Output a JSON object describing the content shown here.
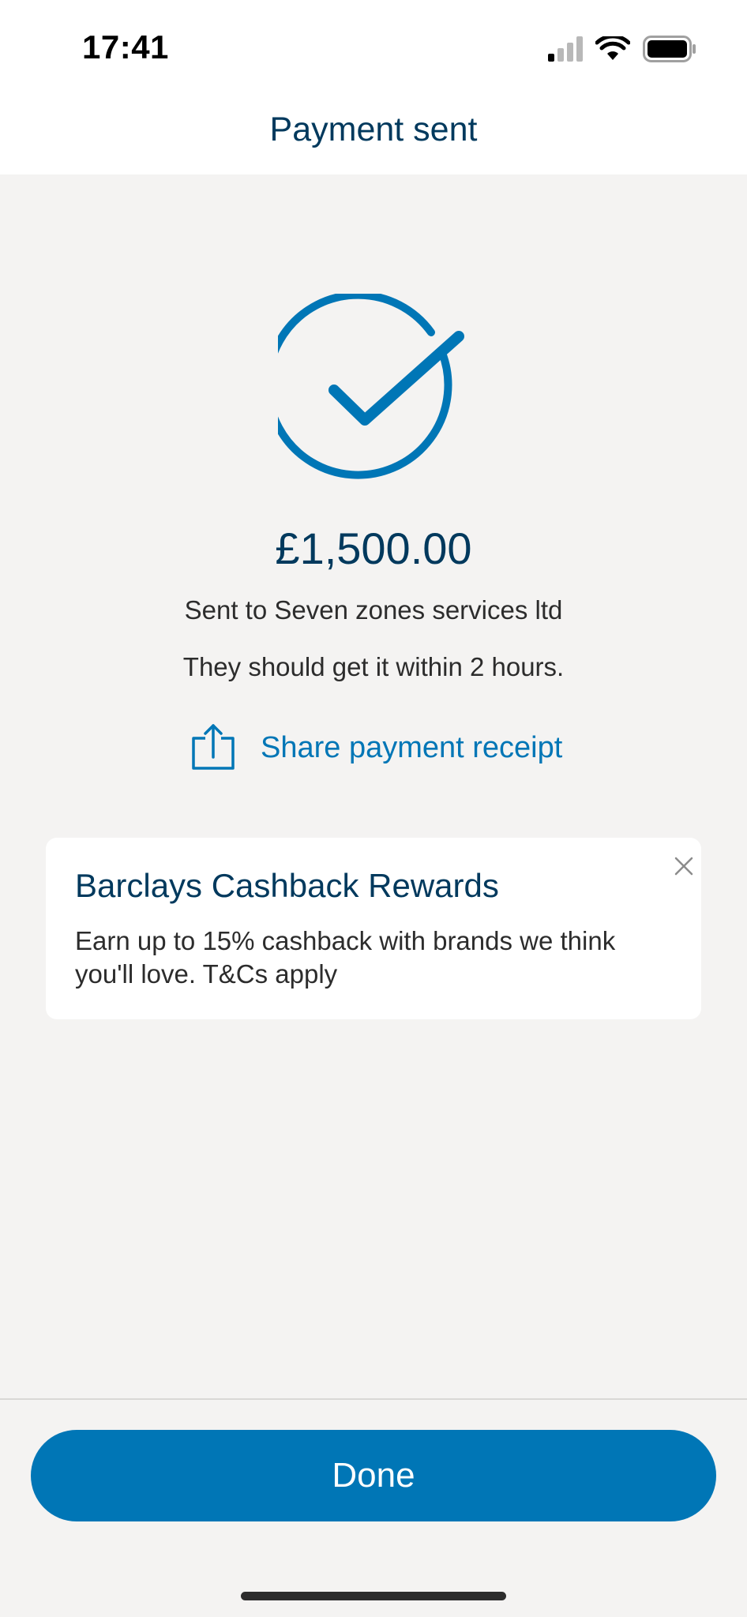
{
  "status_bar": {
    "time": "17:41",
    "icons": [
      "cellular-signal-icon",
      "wifi-icon",
      "battery-icon"
    ]
  },
  "header": {
    "title": "Payment sent"
  },
  "confirmation": {
    "icon": "check-circle-icon",
    "amount": "£1,500.00",
    "recipient_text": "Sent to Seven zones services ltd",
    "eta_text": "They should get it within 2 hours.",
    "share_icon": "share-icon",
    "share_label": "Share payment receipt"
  },
  "promo": {
    "title": "Barclays Cashback Rewards",
    "body": "Earn up to 15% cashback with brands we think you'll love. T&Cs apply",
    "close_icon": "close-icon"
  },
  "footer": {
    "done_label": "Done"
  },
  "colors": {
    "brand_dark": "#00395d",
    "accent_blue": "#0076b6",
    "background": "#f4f3f2",
    "card": "#ffffff"
  }
}
